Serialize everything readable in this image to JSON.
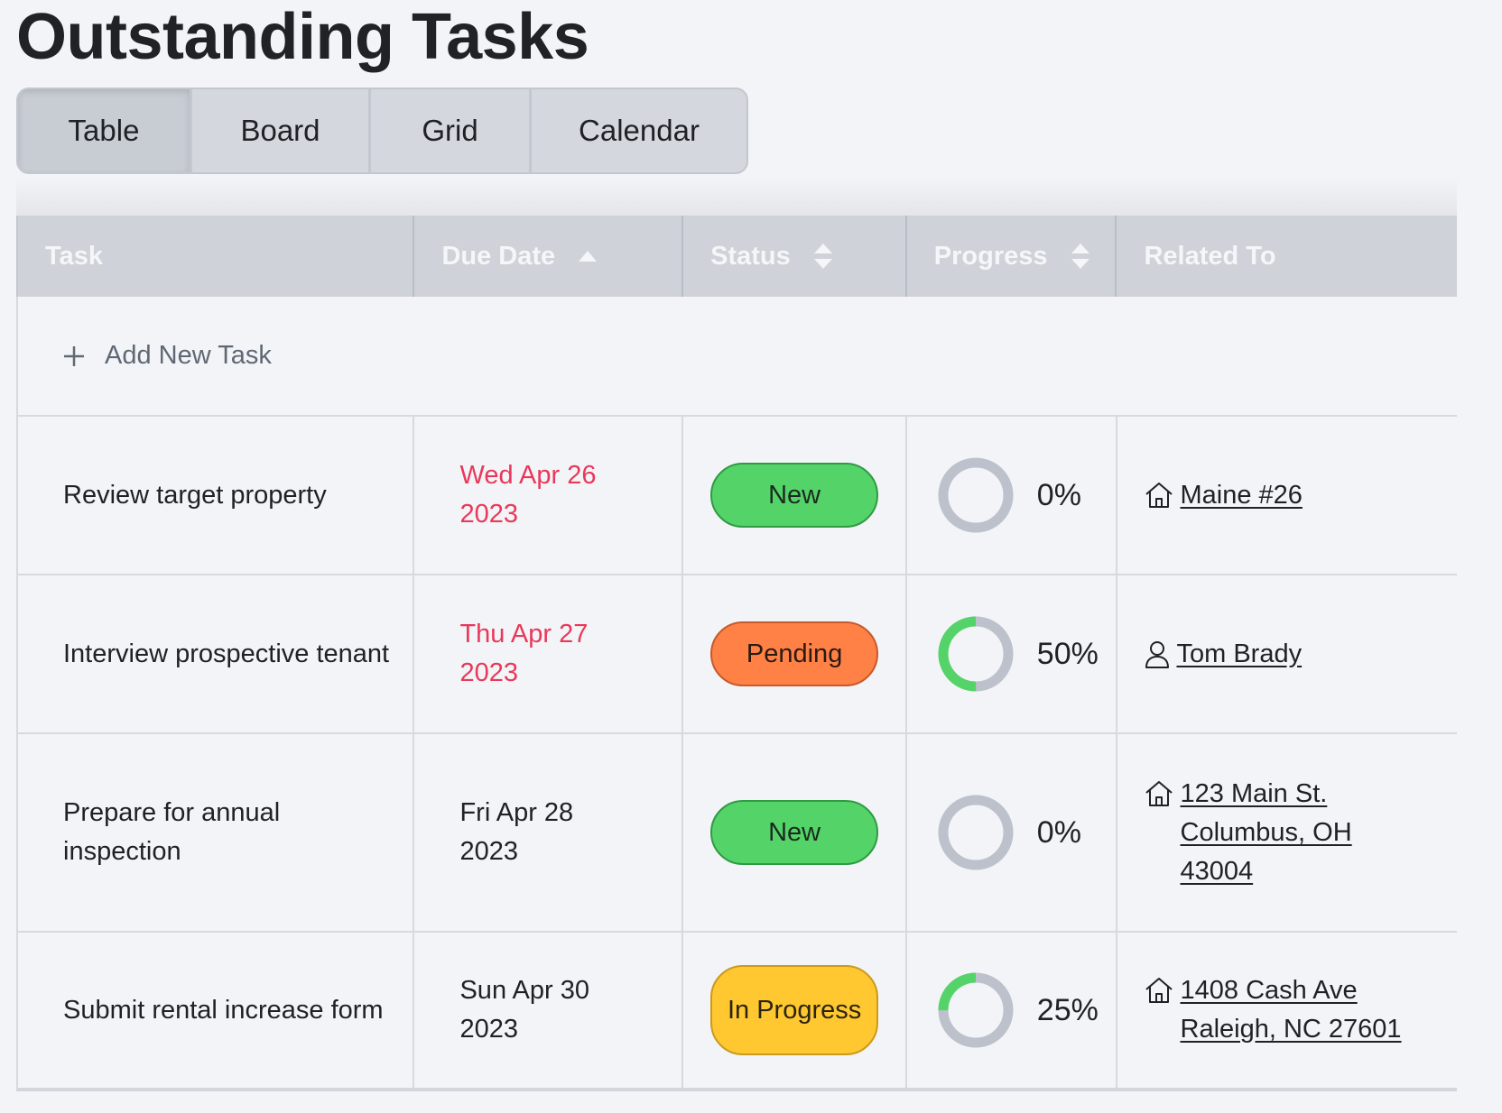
{
  "page": {
    "title": "Outstanding Tasks"
  },
  "view_tabs": [
    {
      "label": "Table",
      "active": true
    },
    {
      "label": "Board",
      "active": false
    },
    {
      "label": "Grid",
      "active": false
    },
    {
      "label": "Calendar",
      "active": false
    }
  ],
  "table": {
    "columns": [
      {
        "label": "Task",
        "sort": "none"
      },
      {
        "label": "Due Date",
        "sort": "ascending"
      },
      {
        "label": "Status",
        "sort": "sortable"
      },
      {
        "label": "Progress",
        "sort": "sortable"
      },
      {
        "label": "Related To",
        "sort": "none"
      }
    ],
    "add_task_label": "Add New Task",
    "rows": [
      {
        "task": "Review target property",
        "due_line1": "Wed Apr 26",
        "due_line2": "2023",
        "overdue": true,
        "status": "New",
        "progress": 0,
        "progress_label": "0%",
        "related_icon": "house-icon",
        "related_lines": [
          "Maine #26"
        ]
      },
      {
        "task": "Interview prospective tenant",
        "due_line1": "Thu Apr 27",
        "due_line2": "2023",
        "overdue": true,
        "status": "Pending",
        "progress": 50,
        "progress_label": "50%",
        "related_icon": "person-icon",
        "related_lines": [
          "Tom Brady"
        ]
      },
      {
        "task": "Prepare for annual inspection",
        "due_line1": "Fri Apr 28",
        "due_line2": "2023",
        "overdue": false,
        "status": "New",
        "progress": 0,
        "progress_label": "0%",
        "related_icon": "house-icon",
        "related_lines": [
          "123 Main St.",
          "Columbus, OH",
          "43004"
        ]
      },
      {
        "task": "Submit rental increase form",
        "due_line1": "Sun Apr 30",
        "due_line2": "2023",
        "overdue": false,
        "status": "In Progress",
        "progress": 25,
        "progress_label": "25%",
        "related_icon": "house-icon",
        "related_lines": [
          "1408 Cash Ave",
          "Raleigh, NC 27601"
        ]
      }
    ]
  },
  "colors": {
    "overdue": "#e8395a",
    "status_new": "#54d468",
    "status_pending": "#ff8146",
    "status_in_progress": "#ffc730",
    "progress_track": "#bcc1cb",
    "progress_fill": "#54d468",
    "header_bg": "#cfd2d8"
  }
}
